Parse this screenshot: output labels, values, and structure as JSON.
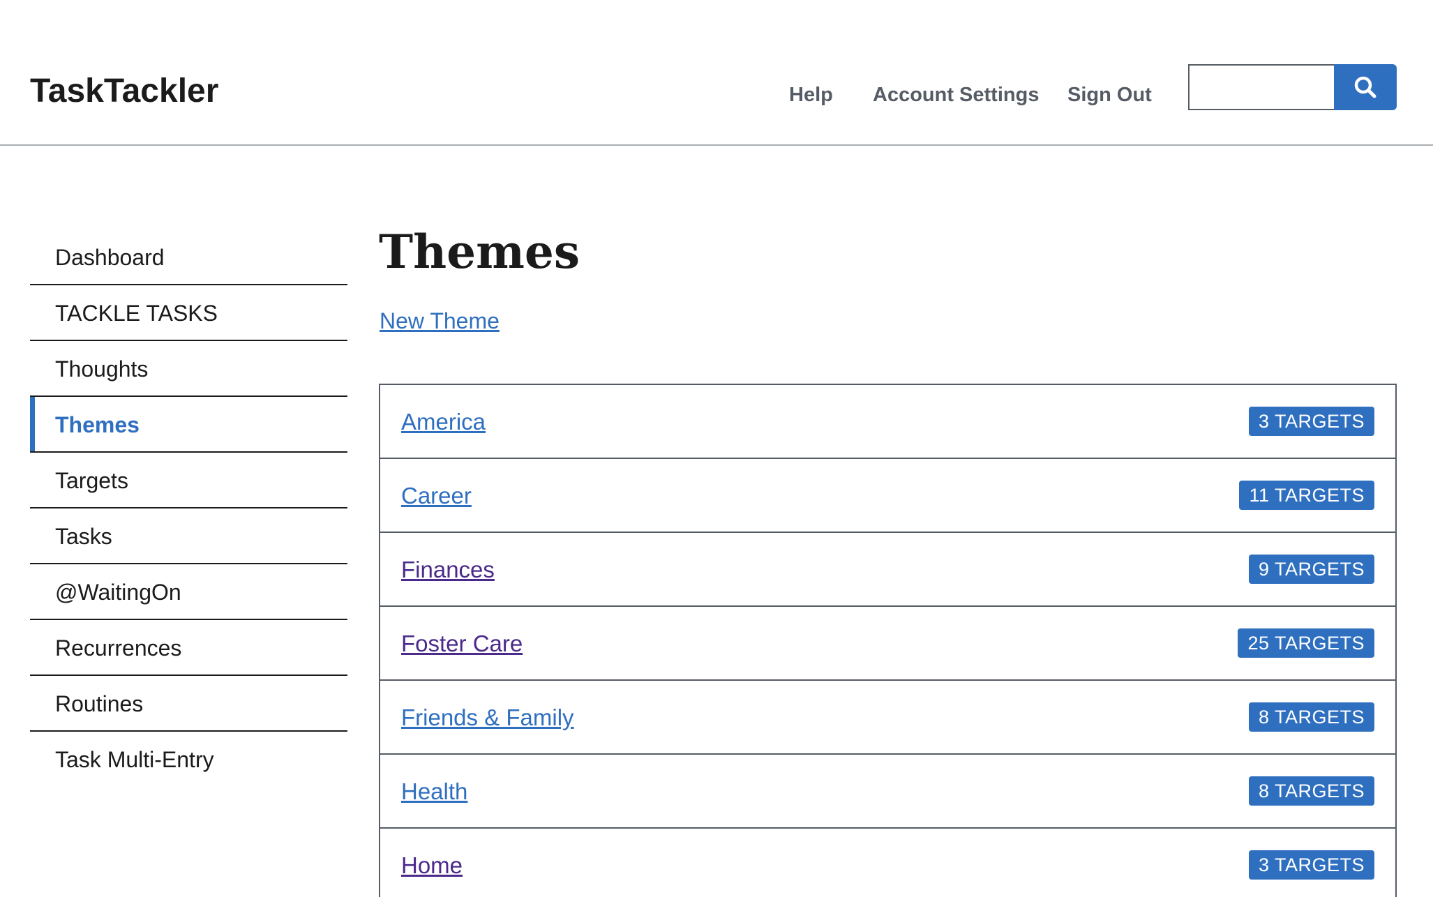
{
  "header": {
    "brand": "TaskTackler",
    "nav": {
      "help": "Help",
      "account_settings": "Account Settings",
      "sign_out": "Sign Out"
    },
    "search": {
      "value": "",
      "icon": "search-icon"
    }
  },
  "sidebar": {
    "items": [
      {
        "label": "Dashboard",
        "current": false
      },
      {
        "label": "TACKLE TASKS",
        "current": false
      },
      {
        "label": "Thoughts",
        "current": false
      },
      {
        "label": "Themes",
        "current": true
      },
      {
        "label": "Targets",
        "current": false
      },
      {
        "label": "Tasks",
        "current": false
      },
      {
        "label": "@WaitingOn",
        "current": false
      },
      {
        "label": "Recurrences",
        "current": false
      },
      {
        "label": "Routines",
        "current": false
      },
      {
        "label": "Task Multi-Entry",
        "current": false
      }
    ]
  },
  "main": {
    "title": "Themes",
    "new_link": "New Theme",
    "themes": [
      {
        "name": "America",
        "badge": "3 TARGETS"
      },
      {
        "name": "Career",
        "badge": "11 TARGETS"
      },
      {
        "name": "Finances",
        "badge": "9 TARGETS"
      },
      {
        "name": "Foster Care",
        "badge": "25 TARGETS"
      },
      {
        "name": "Friends & Family",
        "badge": "8 TARGETS"
      },
      {
        "name": "Health",
        "badge": "8 TARGETS"
      },
      {
        "name": "Home",
        "badge": "3 TARGETS"
      }
    ]
  },
  "colors": {
    "accent": "#2f6fbf",
    "visited_link": "#4b2a8c",
    "nav_text": "#565c65",
    "text": "#1b1b1b"
  }
}
